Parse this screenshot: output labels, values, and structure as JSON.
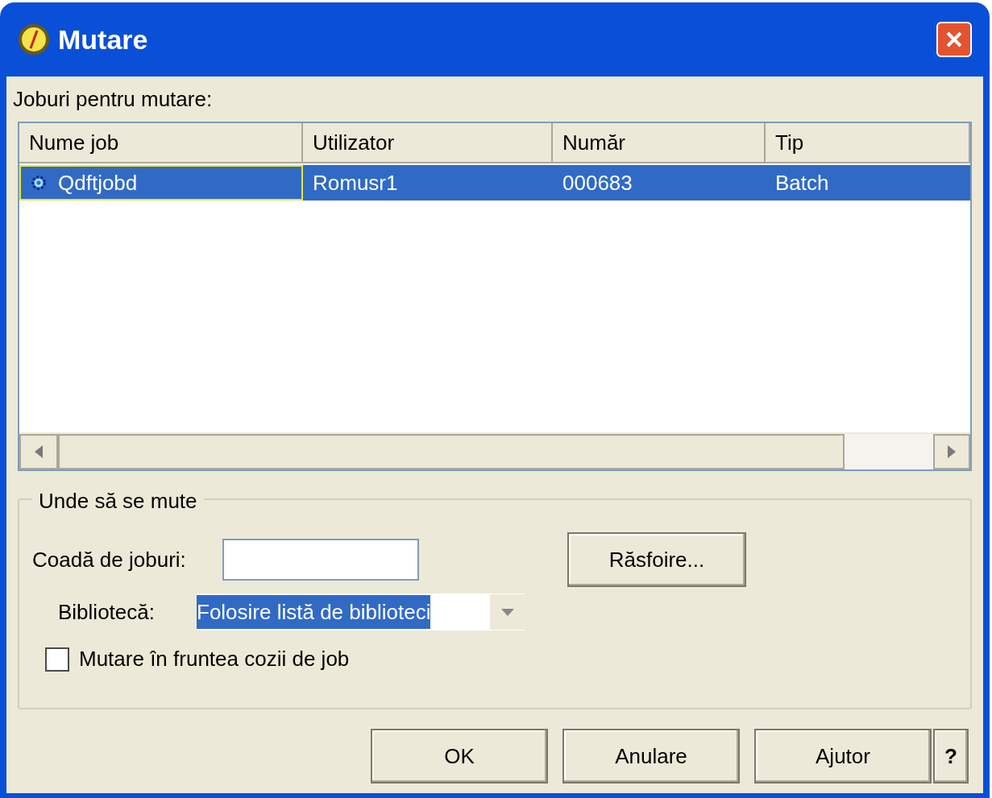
{
  "window": {
    "title": "Mutare"
  },
  "jobs_label": "Joburi pentru mutare:",
  "table": {
    "columns": [
      "Nume job",
      "Utilizator",
      "Număr",
      "Tip"
    ],
    "rows": [
      {
        "cells": [
          "Qdftjobd",
          "Romusr1",
          "000683",
          "Batch"
        ],
        "selected": true
      }
    ]
  },
  "destination": {
    "title": "Unde să se mute",
    "queue": {
      "label": "Coadă de joburi:"
    },
    "browse_button": "Răsfoire...",
    "library": {
      "label": "Bibliotecă:",
      "value": "Folosire listă de biblioteci"
    },
    "to_front": {
      "label": "Mutare în fruntea cozii de job",
      "checked": false
    }
  },
  "buttons": [
    "OK",
    "Anulare",
    "Ajutor",
    "?"
  ]
}
